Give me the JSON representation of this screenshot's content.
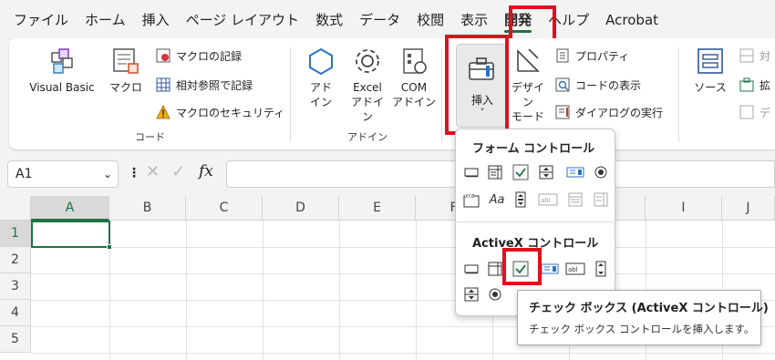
{
  "menu": {
    "tabs": [
      "ファイル",
      "ホーム",
      "挿入",
      "ページ レイアウト",
      "数式",
      "データ",
      "校閲",
      "表示",
      "開発",
      "ヘルプ",
      "Acrobat"
    ],
    "active_tab": "開発"
  },
  "ribbon": {
    "code_group": {
      "label": "コード",
      "visual_basic": "Visual Basic",
      "macro": "マクロ",
      "record_macro": "マクロの記録",
      "relative_ref": "相対参照で記録",
      "macro_security": "マクロのセキュリティ"
    },
    "addin_group": {
      "label": "アドイン",
      "addin_l1": "アド",
      "addin_l2": "イン",
      "excel_l1": "Excel",
      "excel_l2": "アドイン",
      "com_l1": "COM",
      "com_l2": "アドイン"
    },
    "controls_group": {
      "insert": "挿入",
      "insert_chevron": "˅",
      "design_l1": "デザイン",
      "design_l2": "モード",
      "properties": "プロパティ",
      "view_code": "コードの表示",
      "run_dialog": "ダイアログの実行"
    },
    "xml_group": {
      "source": "ソース",
      "item1": "対",
      "item2": "拡",
      "item3": "デ"
    }
  },
  "formula_bar": {
    "name_box": "A1",
    "fx": "fx"
  },
  "grid": {
    "columns": [
      "A",
      "B",
      "C",
      "D",
      "E",
      "F",
      "G",
      "H",
      "I",
      "J"
    ],
    "rows": [
      "1",
      "2",
      "3",
      "4",
      "5"
    ]
  },
  "popup": {
    "form_controls_title": "フォーム コントロール",
    "activex_title": "ActiveX コントロール"
  },
  "tooltip": {
    "title": "チェック ボックス (ActiveX コントロール)",
    "description": "チェック ボックス コントロールを挿入します。"
  },
  "colors": {
    "accent": "#1f7244",
    "highlight": "#e0101d"
  }
}
